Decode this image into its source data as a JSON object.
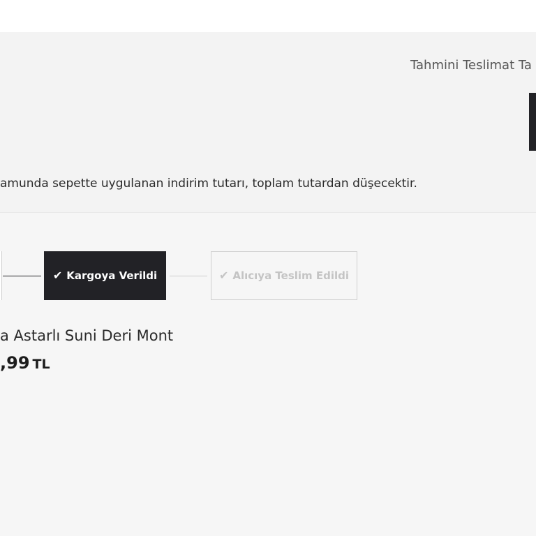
{
  "header": {
    "delivery_estimate": "Tahmini Teslimat Ta"
  },
  "notice": {
    "discount_text": "amunda sepette uygulanan indirim tutarı, toplam tutardan düşecektir."
  },
  "order_status": {
    "steps": [
      {
        "label": "Kargoya Verildi",
        "state": "completed",
        "icon": "check-icon"
      },
      {
        "label": "Alıcıya Teslim Edildi",
        "state": "pending",
        "icon": "check-icon"
      }
    ],
    "check_glyph": "✔"
  },
  "product": {
    "name": "a Astarlı Suni Deri Mont",
    "price": ",99",
    "currency": "TL"
  },
  "colors": {
    "dark": "#222226",
    "panel_gray": "#f3f3f3",
    "order_bg": "#f6f6f6",
    "inactive_text": "#c4c4c4"
  }
}
